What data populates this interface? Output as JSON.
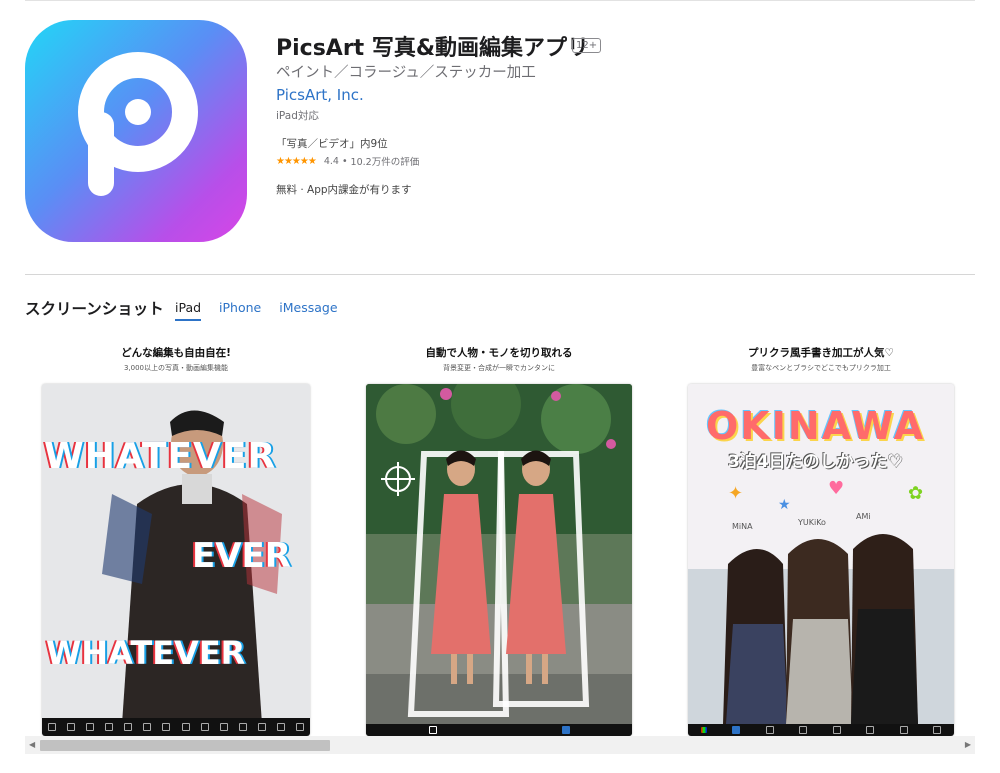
{
  "app": {
    "title": "PicsArt 写真&動画編集アプリ",
    "age_rating": "12+",
    "subtitle": "ペイント／コラージュ／ステッカー加工",
    "developer": "PicsArt, Inc.",
    "device_note": "iPad対応",
    "rank": "「写真／ビデオ」内9位",
    "stars": "★★★★★",
    "rating_value": "4.4",
    "rating_separator": "•",
    "rating_count": "10.2万件の評価",
    "price": "無料 · App内課金が有ります"
  },
  "screenshots": {
    "section_title": "スクリーンショット",
    "tabs": [
      {
        "label": "iPad"
      },
      {
        "label": "iPhone"
      },
      {
        "label": "iMessage"
      }
    ],
    "items": [
      {
        "caption": "どんな編集も自由自在!",
        "sub": "3,000以上の写真・動画編集機能",
        "overlay": [
          "WHATEVER",
          "EVER",
          "WHATEVER"
        ]
      },
      {
        "caption": "自動で人物・モノを切り取れる",
        "sub": "背景変更・合成が一瞬でカンタンに"
      },
      {
        "caption": "プリクラ風手書き加工が人気♡",
        "sub": "豊富なペンとブラシでどこでもプリクラ加工",
        "overlay": [
          "OKINAWA",
          "3泊4日たのしかった♡",
          "MiNA",
          "YUKiKo",
          "AMi"
        ]
      }
    ]
  },
  "scrollbar": {
    "left_arrow": "◀",
    "right_arrow": "▶"
  }
}
